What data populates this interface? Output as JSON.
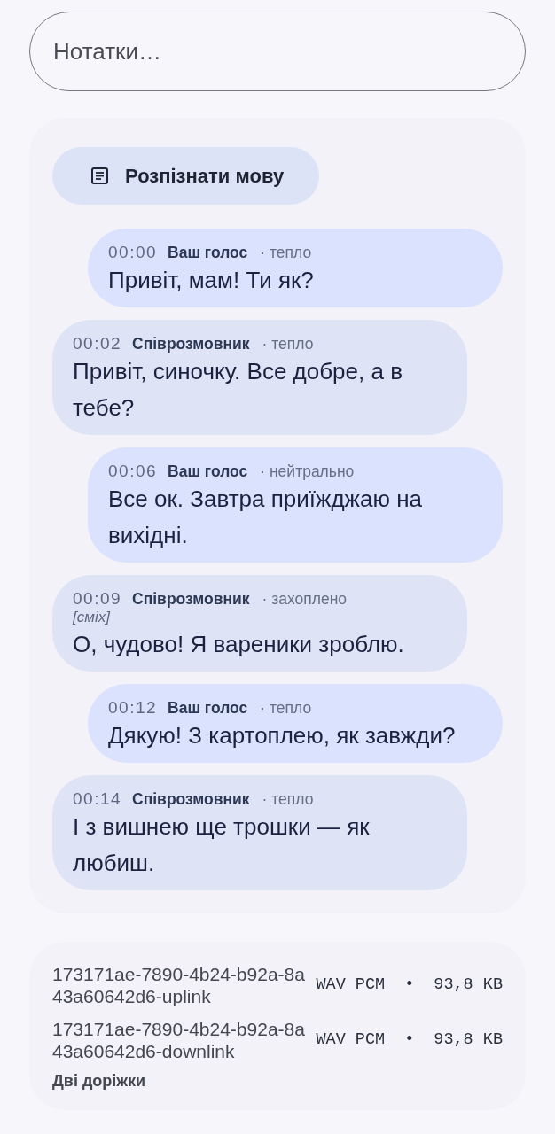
{
  "notes_field": {
    "placeholder": "Нотатки…"
  },
  "transcript": {
    "recognize_button": {
      "label": "Розпізнати мову"
    },
    "messages": [
      {
        "kind": "self",
        "time": "00:00",
        "speaker": "Ваш голос",
        "tone": "· тепло",
        "text": "Привіт, мам! Ти як?"
      },
      {
        "kind": "other",
        "time": "00:02",
        "speaker": "Співрозмовник",
        "tone": "· тепло",
        "text": "Привіт, синочку. Все добре, а в тебе?"
      },
      {
        "kind": "self",
        "time": "00:06",
        "speaker": "Ваш голос",
        "tone": "· нейтрально",
        "text": "Все ок. Завтра приїжджаю на вихідні."
      },
      {
        "kind": "other",
        "time": "00:09",
        "speaker": "Співрозмовник",
        "tone": "· захоплено",
        "annotation": "[сміх]",
        "text": "О, чудово! Я вареники зроблю."
      },
      {
        "kind": "self",
        "time": "00:12",
        "speaker": "Ваш голос",
        "tone": "· тепло",
        "text": "Дякую! З картоплею, як завжди?"
      },
      {
        "kind": "other",
        "time": "00:14",
        "speaker": "Співрозмовник",
        "tone": "· тепло",
        "text": "І з вишнею ще трошки — як любиш."
      }
    ]
  },
  "files": {
    "items": [
      {
        "name": "173171ae-7890-4b24-b92a-8a43a60642d6-uplink",
        "format": "WAV PCM",
        "separator": "•",
        "size": "93,8 KB"
      },
      {
        "name": "173171ae-7890-4b24-b92a-8a43a60642d6-downlink",
        "format": "WAV PCM",
        "separator": "•",
        "size": "93,8 KB"
      }
    ],
    "caption": "Дві доріжки"
  }
}
